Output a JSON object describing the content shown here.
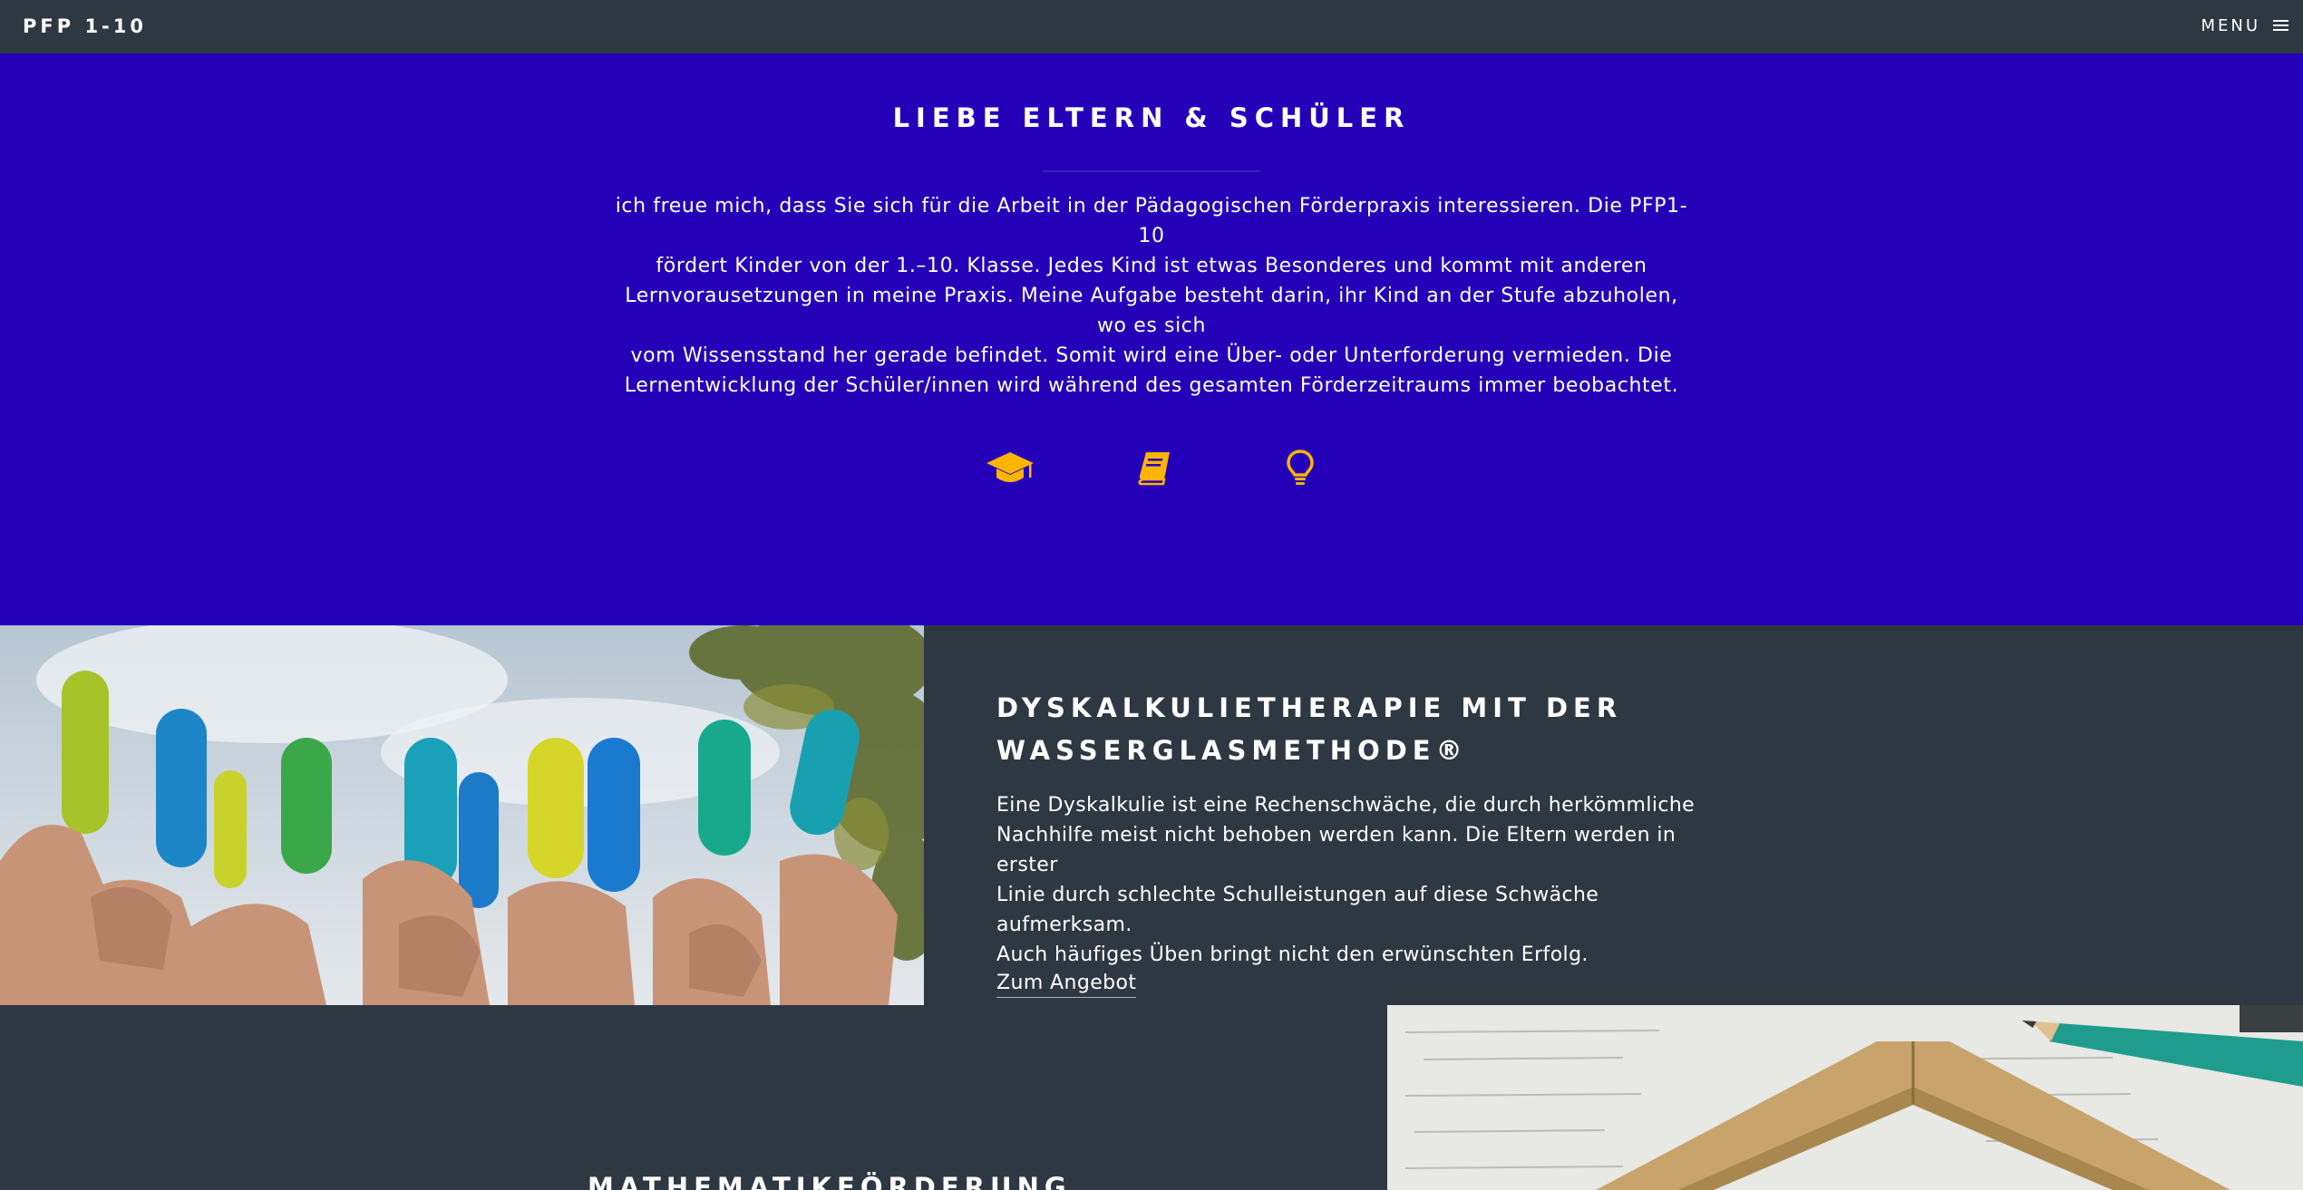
{
  "header": {
    "brand": "PFP 1-10",
    "menu_label": "MENU",
    "menu_icon": "hamburger-icon"
  },
  "intro": {
    "title": "LIEBE ELTERN & SCHÜLER",
    "lines": [
      "ich freue mich, dass Sie sich für die Arbeit in der Pädagogischen Förderpraxis interessieren. Die PFP1-10",
      "fördert Kinder von der 1.–10. Klasse. Jedes Kind ist etwas Besonderes und kommt mit anderen",
      "Lernvorausetzungen in meine Praxis. Meine Aufgabe besteht darin, ihr Kind an der Stufe abzuholen, wo es sich",
      "vom Wissensstand her gerade befindet. Somit wird eine Über- oder Unterforderung vermieden. Die",
      "Lernentwicklung der Schüler/innen wird während des gesamten Förderzeitraums immer beobachtet."
    ],
    "icons": [
      "graduation-cap-icon",
      "book-icon",
      "lightbulb-icon"
    ],
    "icon_color": "#ffb400",
    "background": "#2400b8"
  },
  "dyskalkulie": {
    "title_line1": "DYSKALKULIETHERAPIE MIT DER",
    "title_line2": "WASSERGLASMETHODE®",
    "lines": [
      "Eine Dyskalkulie ist eine Rechenschwäche, die durch herkömmliche",
      "Nachhilfe meist nicht behoben werden kann. Die Eltern werden in erster",
      "Linie durch schlechte Schulleistungen auf diese Schwäche aufmerksam.",
      "Auch häufiges Üben bringt nicht den erwünschten Erfolg."
    ],
    "link": "Zum Angebot",
    "image": "hands-holding-colored-test-tubes-photo"
  },
  "mathematik": {
    "title": "MATHEMATIKFÖRDERUNG",
    "image": "worksheet-pencil-wooden-frame-photo"
  },
  "colors": {
    "page_bg": "#2e3842",
    "accent": "#2400b8",
    "icon": "#ffb400"
  }
}
